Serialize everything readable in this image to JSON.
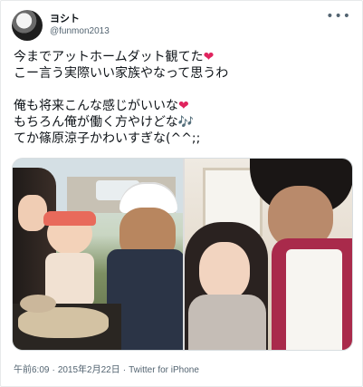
{
  "author": {
    "display_name": "ヨシト",
    "handle": "@funmon2013"
  },
  "menu": {
    "more_icon": "more-horizontal-icon"
  },
  "tweet": {
    "lines": [
      "今までアットホームダット観てた",
      "こー言う実際いい家族やなって思うわ",
      "",
      "俺も将来こんな感じがいいな",
      "もちろん俺が働く方やけどな",
      "てか篠原涼子かわいすぎな(^^;;"
    ],
    "emoji": {
      "line1": "❤",
      "line4": "❤",
      "line5": "🎶"
    }
  },
  "media": {
    "images": [
      "family-cooking-photo",
      "couple-cooking-photo"
    ]
  },
  "meta": {
    "time": "午前6:09",
    "separator": "·",
    "date": "2015年2月22日",
    "source": "Twitter for iPhone"
  },
  "colors": {
    "heart": "#e0245e",
    "notes": "#3a9be0",
    "secondary_text": "#536471"
  }
}
